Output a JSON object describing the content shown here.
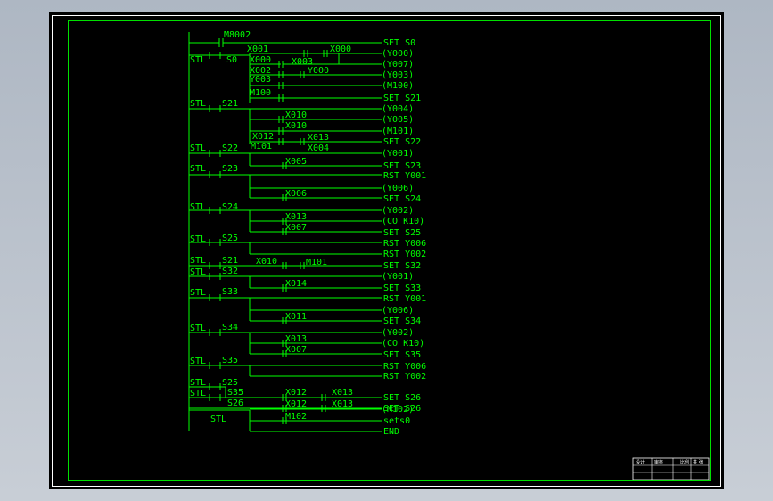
{
  "labels": {
    "m8002": "M8002",
    "set_s0": "SET S0",
    "stl": "STL",
    "s0": "S0",
    "x001": "X001",
    "x000_a": "X000",
    "y000_out": "(Y000)",
    "x000_b": "X000",
    "x003": "X003",
    "y007_out": "(Y007)",
    "x002": "X002",
    "y000_c": "Y000",
    "y003_out": "(Y003)",
    "y003_c": "Y003",
    "m100_out": "(M100)",
    "m100_c": "M100",
    "set_s21": "SET S21",
    "s21": "S21",
    "y004_out": "(Y004)",
    "x010_a": "X010",
    "y005_out": "(Y005)",
    "x010_b": "X010",
    "m101_out": "(M101)",
    "x012_a": "X012",
    "x013_a": "X013",
    "set_s22": "SET S22",
    "s22": "S22",
    "m101_c": "M101",
    "x004": "X004",
    "y001_out_a": "(Y001)",
    "x005": "X005",
    "s23": "S23",
    "set_s23": "SET S23",
    "rst_y001_a": "RST Y001",
    "y006_out_a": "(Y006)",
    "x006": "X006",
    "set_s24": "SET S24",
    "s24": "S24",
    "y002_out_a": "(Y002)",
    "x013_b": "X013",
    "co_k10_a": "(CO K10)",
    "x007_a": "X007",
    "set_s25": "SET S25",
    "s25": "S25",
    "rst_y006_a": "RST Y006",
    "rst_y002_a": "RST Y002",
    "s21_b": "S21",
    "x010_c": "X010",
    "m101_d": "M101",
    "set_s32": "SET S32",
    "s32": "S32",
    "y001_out_b": "(Y001)",
    "x014": "X014",
    "s33": "S33",
    "set_s33": "SET S33",
    "rst_y001_b": "RST Y001",
    "y006_out_b": "(Y006)",
    "x011": "X011",
    "set_s34": "SET S34",
    "s34": "S34",
    "y002_out_b": "(Y002)",
    "x013_c": "X013",
    "co_k10_b": "(CO K10)",
    "x007_b": "X007",
    "set_s35": "SET S35",
    "s35": "S35",
    "rst_y006_b": "RST Y006",
    "rst_y002_b": "RST Y002",
    "s25_b": "S25",
    "s35_b": "S35",
    "x012_b": "X012",
    "x013_d": "X013",
    "set_s26_a": "SET S26",
    "s26": "S26",
    "x012_c": "X012",
    "x013_e": "X013",
    "set_s26_b": "SET S26",
    "m102_out": "(M102)",
    "m102_c": "M102",
    "sets0": "sets0",
    "end": "END"
  },
  "title_block": {
    "c1": "设计",
    "c2": "审核",
    "c3": "比例",
    "c4": "共 张"
  },
  "colors": {
    "ladder": "#00ff00",
    "frame_outer": "#ffffff",
    "frame_inner": "#00e000",
    "background": "#000000"
  }
}
